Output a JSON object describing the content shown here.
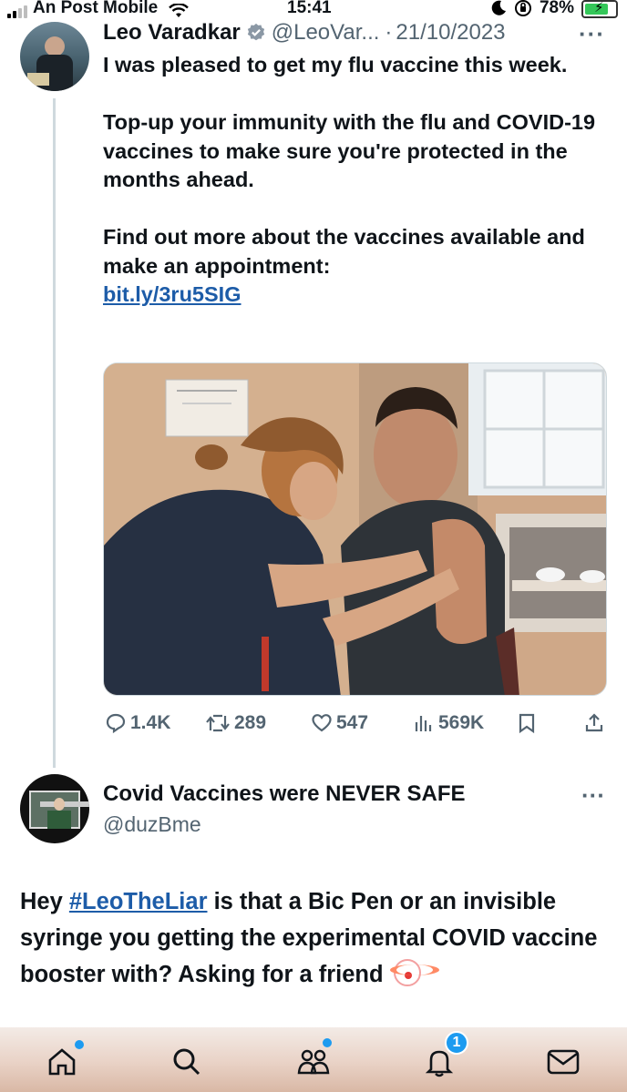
{
  "status_bar": {
    "carrier": "An Post Mobile",
    "time": "15:41",
    "battery": "78%",
    "battery_level": 0.78,
    "battery_color": "#34c759"
  },
  "tweet": {
    "author_name": "Leo Varadkar",
    "handle": "@LeoVar...",
    "date_sep": "·",
    "date": "21/10/2023",
    "more": "···",
    "avatar_icon": "profile-photo",
    "verified_icon": "verified-badge-icon",
    "lines": {
      "p1": "I was pleased to get my flu vaccine this week.",
      "p2": "Top-up your immunity with the flu and COVID-19 vaccines to make sure you're protected in the months ahead.",
      "p3": "Find out more about the vaccines available and make an appointment:",
      "link": "bit.ly/3ru5SIG"
    },
    "media_description_icon": "vaccination-photo",
    "actions": {
      "replies": "1.4K",
      "retweets": "289",
      "likes": "547",
      "views": "569K"
    }
  },
  "reply": {
    "author_name": "Covid Vaccines were NEVER SAFE",
    "handle": "@duzBme",
    "more": "···",
    "text_prefix": "Hey ",
    "hashtag": "#LeoTheLiar",
    "text_rest": " is that a Bic Pen or an invisible syringe you getting the experimental COVID vaccine booster with? Asking for a friend",
    "emoji_icon": "clown-face-icon"
  },
  "bottom_nav": {
    "items": [
      "home",
      "search",
      "communities",
      "notifications",
      "messages"
    ],
    "notification_count": "1",
    "accent": "#1d9bf0"
  },
  "colors": {
    "link": "#1d5ca8",
    "secondary": "#536471",
    "primary_text": "#0f1419"
  }
}
